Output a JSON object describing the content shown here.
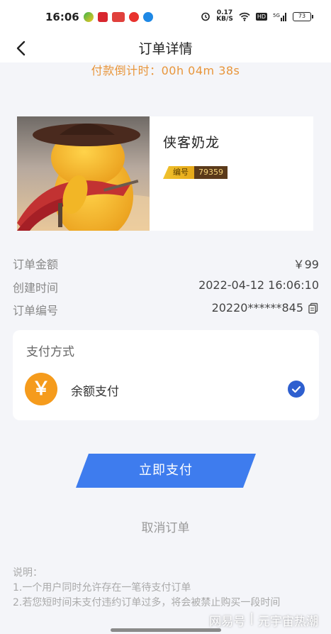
{
  "status_bar": {
    "time": "16:06",
    "net_speed": "0.17\nKB/S",
    "battery": "73",
    "icons": [
      "green-app-icon",
      "red-app-icon",
      "red-news-app-icon",
      "weibo-icon",
      "blue-app-icon",
      "alarm-icon",
      "wifi-icon",
      "hd-icon",
      "signal-5g-icon",
      "battery-icon"
    ]
  },
  "nav": {
    "title": "订单详情"
  },
  "countdown": "付款倒计时：00h 04m 38s",
  "product": {
    "name": "侠客奶龙",
    "serial_label": "编号",
    "serial_number": "79359"
  },
  "order_info": {
    "amount_label": "订单金额",
    "amount_value": "￥99",
    "created_label": "创建时间",
    "created_value": "2022-04-12 16:06:10",
    "number_label": "订单编号",
    "number_value": "20220******845"
  },
  "payment": {
    "title": "支付方式",
    "method_name": "余额支付",
    "method_icon": "￥",
    "selected": true
  },
  "actions": {
    "pay_label": "立即支付",
    "cancel_label": "取消订单"
  },
  "notes": {
    "title": "说明：",
    "line1": "1.一个用户同时允许存在一笔待支付订单",
    "line2": "2.若您短时间未支付违约订单过多，将会被禁止购买一段时间"
  },
  "watermark": {
    "brand": "网易号",
    "account": "元宇宙热潮"
  },
  "colors": {
    "accent": "#3e7cee",
    "countdown": "#e8953a",
    "yen_icon": "#f59b1c",
    "check": "#2e5fcf",
    "page_bg": "#f4f5f9"
  }
}
